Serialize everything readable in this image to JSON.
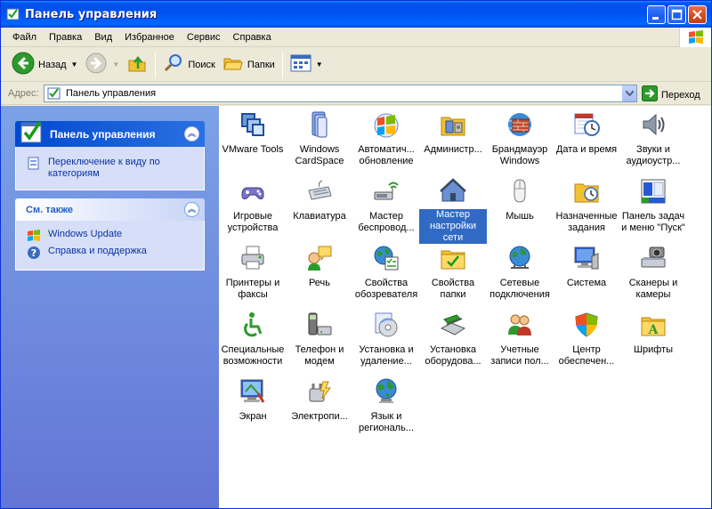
{
  "window": {
    "title": "Панель управления"
  },
  "menu": [
    {
      "label": "Файл"
    },
    {
      "label": "Правка"
    },
    {
      "label": "Вид"
    },
    {
      "label": "Избранное"
    },
    {
      "label": "Сервис"
    },
    {
      "label": "Справка"
    }
  ],
  "toolbar": {
    "back": "Назад",
    "search": "Поиск",
    "folders": "Папки"
  },
  "address": {
    "label": "Адрес:",
    "value": "Панель управления",
    "go": "Переход"
  },
  "tasks": {
    "title": "Панель управления",
    "switch_view": "Переключение к виду по категориям"
  },
  "see_also": {
    "title": "См. также",
    "links": [
      "Windows Update",
      "Справка и поддержка"
    ]
  },
  "items": [
    {
      "label": "VMware Tools",
      "icon": "vmware-icon"
    },
    {
      "label": "Windows CardSpace",
      "icon": "cardspace-icon"
    },
    {
      "label": "Автоматич... обновление",
      "icon": "automatic-updates-icon"
    },
    {
      "label": "Администр...",
      "icon": "administrative-tools-icon"
    },
    {
      "label": "Брандмауэр Windows",
      "icon": "firewall-icon"
    },
    {
      "label": "Дата и время",
      "icon": "date-time-icon"
    },
    {
      "label": "Звуки и аудиоустр...",
      "icon": "sounds-icon"
    },
    {
      "label": "Игровые устройства",
      "icon": "game-controllers-icon"
    },
    {
      "label": "Клавиатура",
      "icon": "keyboard-icon"
    },
    {
      "label": "Мастер беспровод...",
      "icon": "wireless-wizard-icon"
    },
    {
      "label": "Мастер настройки сети",
      "icon": "network-setup-icon",
      "selected": true
    },
    {
      "label": "Мышь",
      "icon": "mouse-icon"
    },
    {
      "label": "Назначенные задания",
      "icon": "scheduled-tasks-icon"
    },
    {
      "label": "Панель задач и меню \"Пуск\"",
      "icon": "taskbar-start-icon"
    },
    {
      "label": "Принтеры и факсы",
      "icon": "printers-icon"
    },
    {
      "label": "Речь",
      "icon": "speech-icon"
    },
    {
      "label": "Свойства обозревателя",
      "icon": "internet-options-icon"
    },
    {
      "label": "Свойства папки",
      "icon": "folder-options-icon"
    },
    {
      "label": "Сетевые подключения",
      "icon": "network-connections-icon"
    },
    {
      "label": "Система",
      "icon": "system-icon"
    },
    {
      "label": "Сканеры и камеры",
      "icon": "scanners-cameras-icon"
    },
    {
      "label": "Специальные возможности",
      "icon": "accessibility-icon"
    },
    {
      "label": "Телефон и модем",
      "icon": "phone-modem-icon"
    },
    {
      "label": "Установка и удаление...",
      "icon": "add-remove-programs-icon"
    },
    {
      "label": "Установка оборудова...",
      "icon": "add-hardware-icon"
    },
    {
      "label": "Учетные записи пол...",
      "icon": "user-accounts-icon"
    },
    {
      "label": "Центр обеспечен...",
      "icon": "security-center-icon"
    },
    {
      "label": "Шрифты",
      "icon": "fonts-icon"
    },
    {
      "label": "Экран",
      "icon": "display-icon"
    },
    {
      "label": "Электропи...",
      "icon": "power-options-icon"
    },
    {
      "label": "Язык и региональ...",
      "icon": "regional-options-icon"
    }
  ]
}
